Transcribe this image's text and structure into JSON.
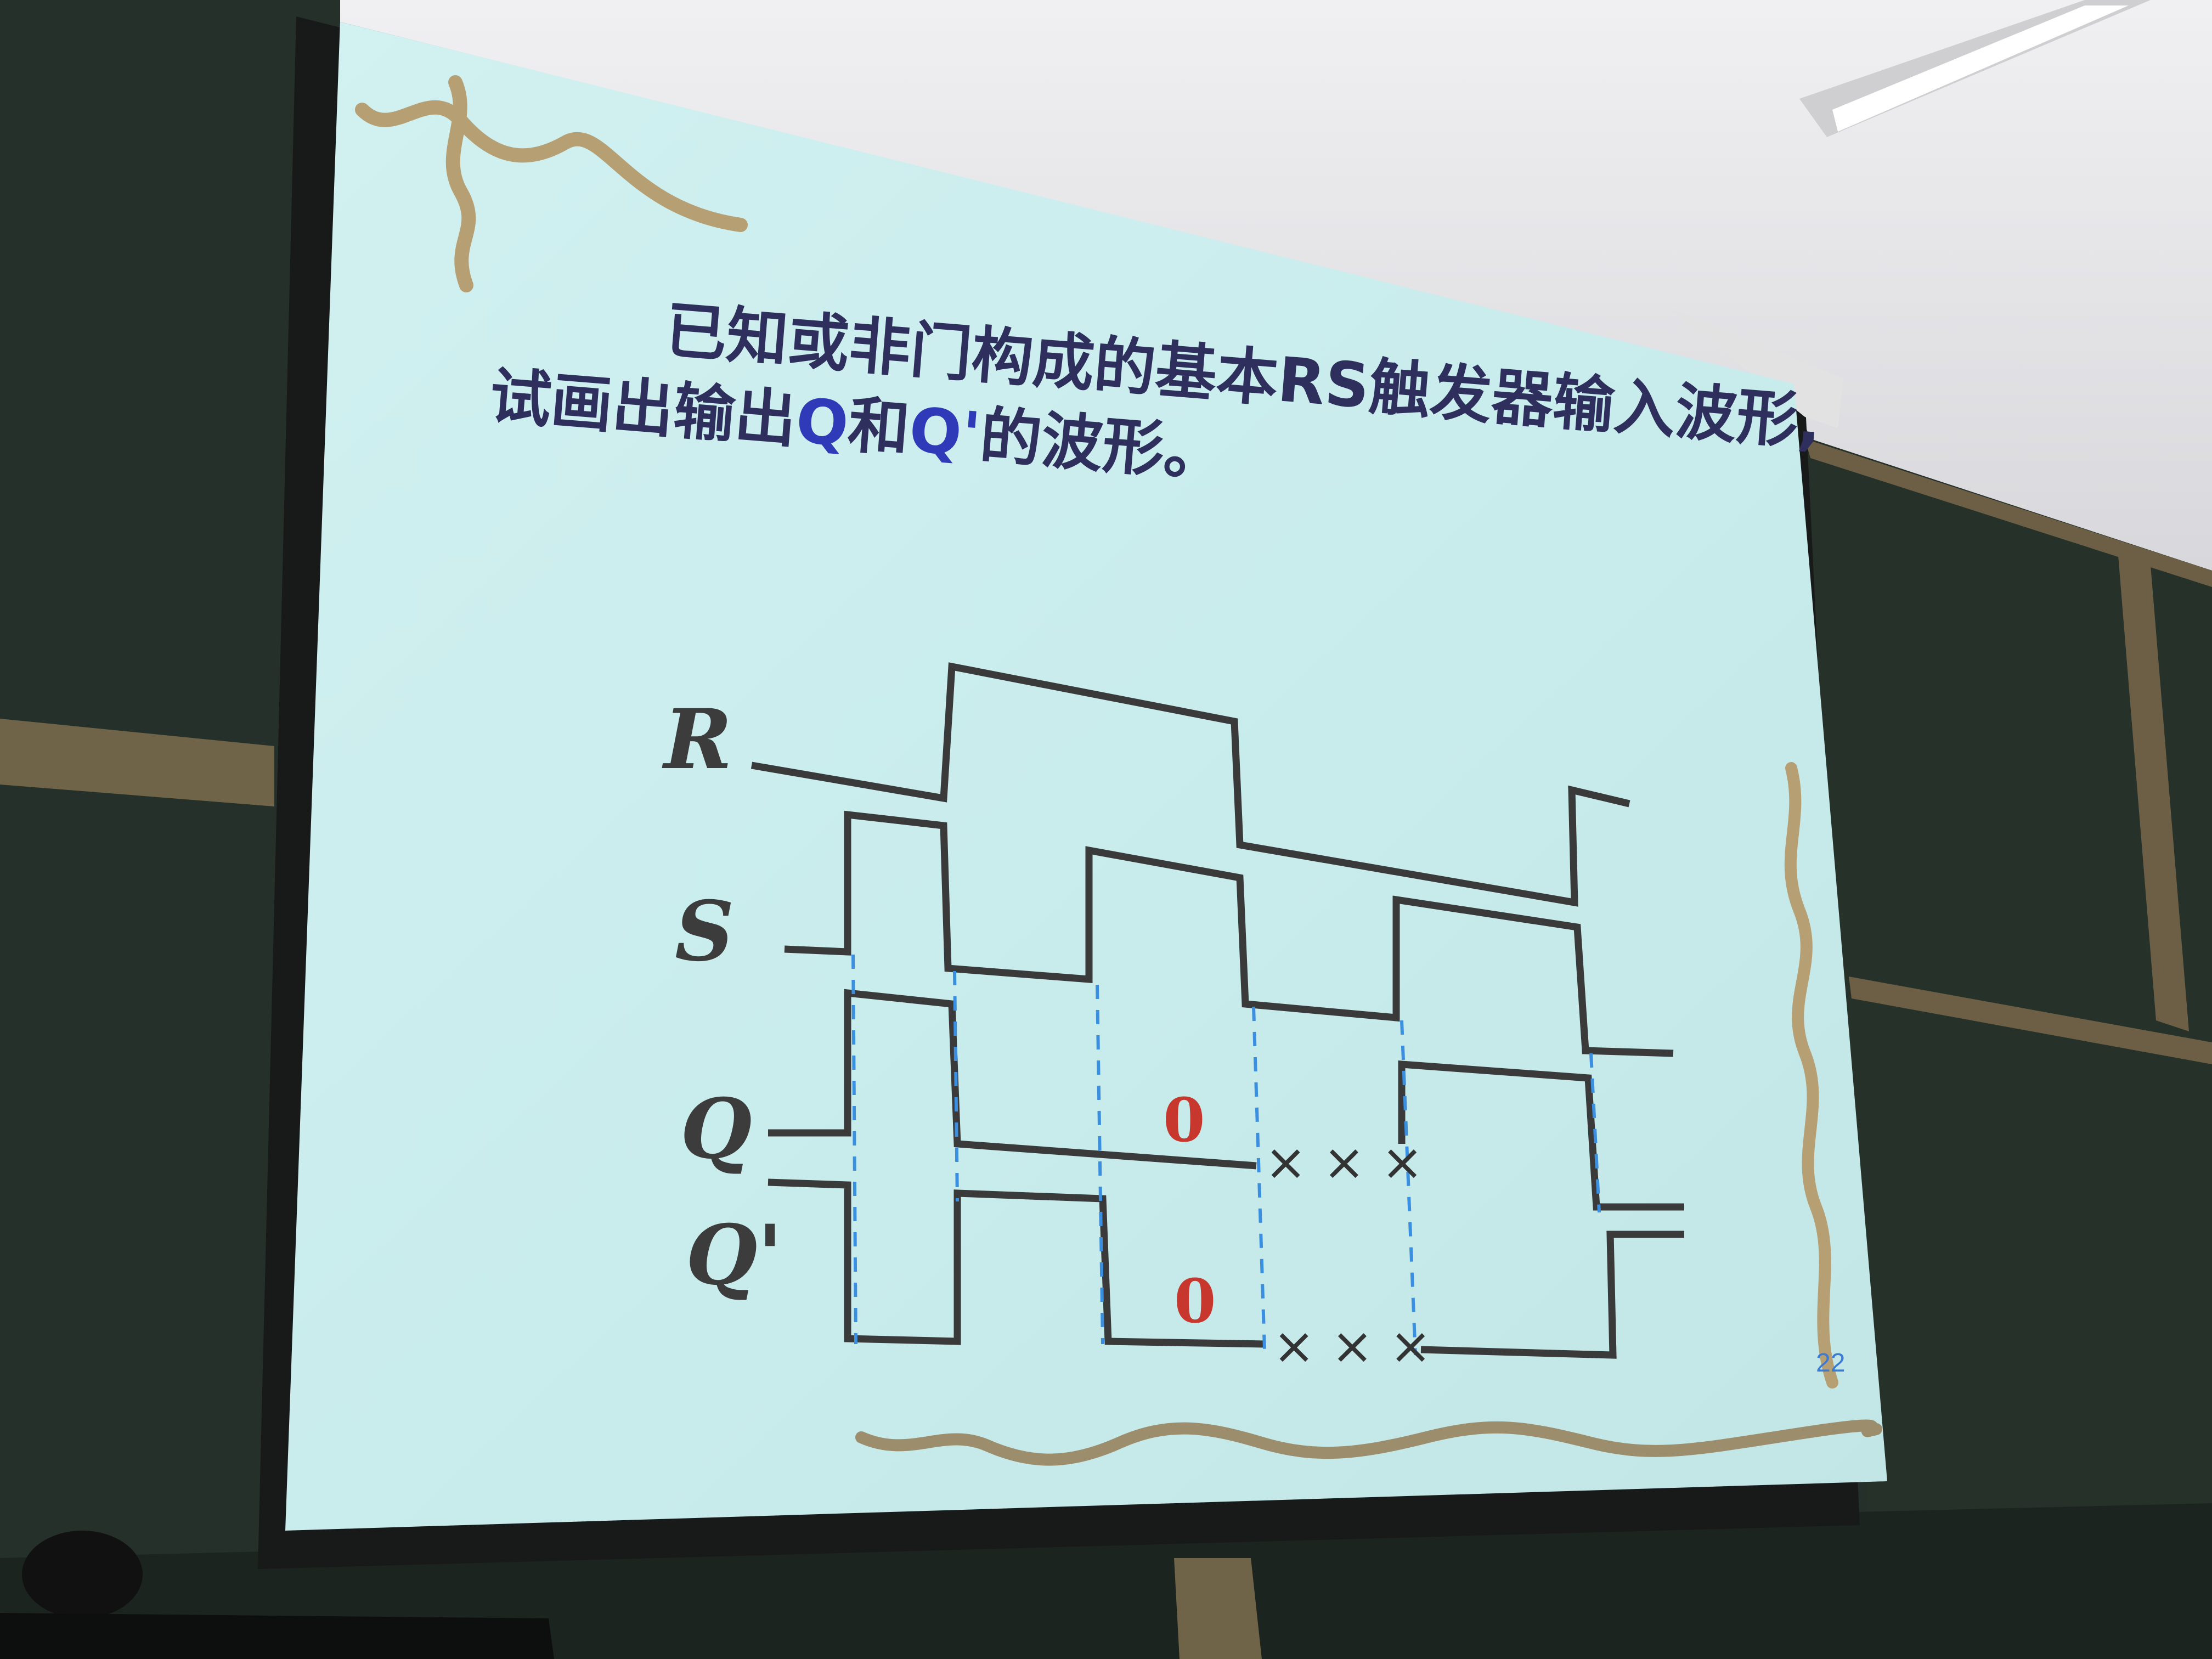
{
  "slide": {
    "title_line1": "已知或非门构成的基本RS触发器输入波形,",
    "title_line2": {
      "pre": "试画出输出",
      "q": "Q",
      "mid": "和",
      "qprime": "Q'",
      "post": "的波形。"
    },
    "signals": [
      "R",
      "S",
      "Q",
      "Q'"
    ],
    "annotations": {
      "q_value": "0",
      "qprime_value": "0",
      "q_undefined": "× × ×",
      "qprime_undefined": "× × ×"
    },
    "page_number": "22"
  },
  "colors": {
    "screen": "#cdeeee",
    "waveform": "#3a3a3a",
    "dashed_guides": "#3b8fe0",
    "title_text": "#2f2f5e",
    "title_emphasis": "#2f3ab8",
    "zero_marks": "#c8372d",
    "chalkboard": "#1f2a25",
    "wall": "#e6e6e8"
  }
}
